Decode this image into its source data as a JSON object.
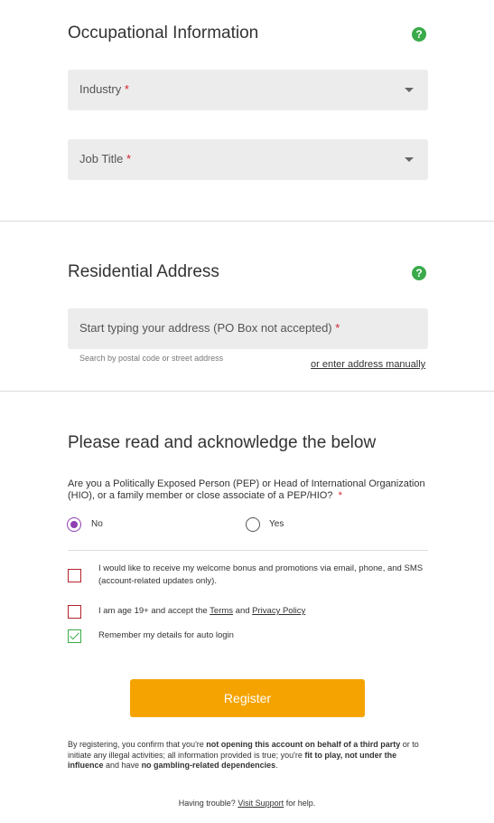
{
  "occupational": {
    "title": "Occupational Information",
    "help_glyph": "?",
    "industry_label": "Industry",
    "job_title_label": "Job Title",
    "required_mark": "*"
  },
  "address": {
    "title": "Residential Address",
    "help_glyph": "?",
    "input_label": "Start typing your address (PO Box not accepted)",
    "required_mark": "*",
    "hint": "Search by postal code or street address",
    "manual_link": "or enter address manually"
  },
  "acknowledge": {
    "title": "Please read and acknowledge the below",
    "pep_question": "Are you a Politically Exposed Person (PEP) or Head of International Organization (HIO), or a family member or close associate of a PEP/HIO?",
    "required_mark": "*",
    "options": [
      {
        "label": "No",
        "selected": true
      },
      {
        "label": "Yes",
        "selected": false
      }
    ],
    "promo_label": "I would like to receive my welcome bonus and promotions via email, phone, and SMS (account-related updates only).",
    "age_prefix": "I am age 19+ and accept the ",
    "terms_link": "Terms",
    "and_text": " and ",
    "privacy_link": "Privacy Policy",
    "remember_label": "Remember my details for auto login",
    "promo_checked": false,
    "age_checked": false,
    "remember_checked": true
  },
  "register_button": "Register",
  "legal": {
    "p1": "By registering, you confirm that you're ",
    "b1": "not opening this account on behalf of a third party",
    "p2": " or to initiate any illegal activities; all information provided is true; you're ",
    "b2": "fit to play, not under the influence",
    "p3": " and have ",
    "b3": "no gambling-related dependencies",
    "p4": "."
  },
  "footer": {
    "prefix": "Having trouble? ",
    "link": "Visit Support",
    "suffix": " for help."
  },
  "colors": {
    "accent_button": "#f5a300",
    "help_icon": "#3aaa4a",
    "required": "#d2222d",
    "radio_selected": "#8d3fb1"
  },
  "icons": [
    "help-icon",
    "dropdown-caret-icon",
    "checkmark-icon"
  ]
}
